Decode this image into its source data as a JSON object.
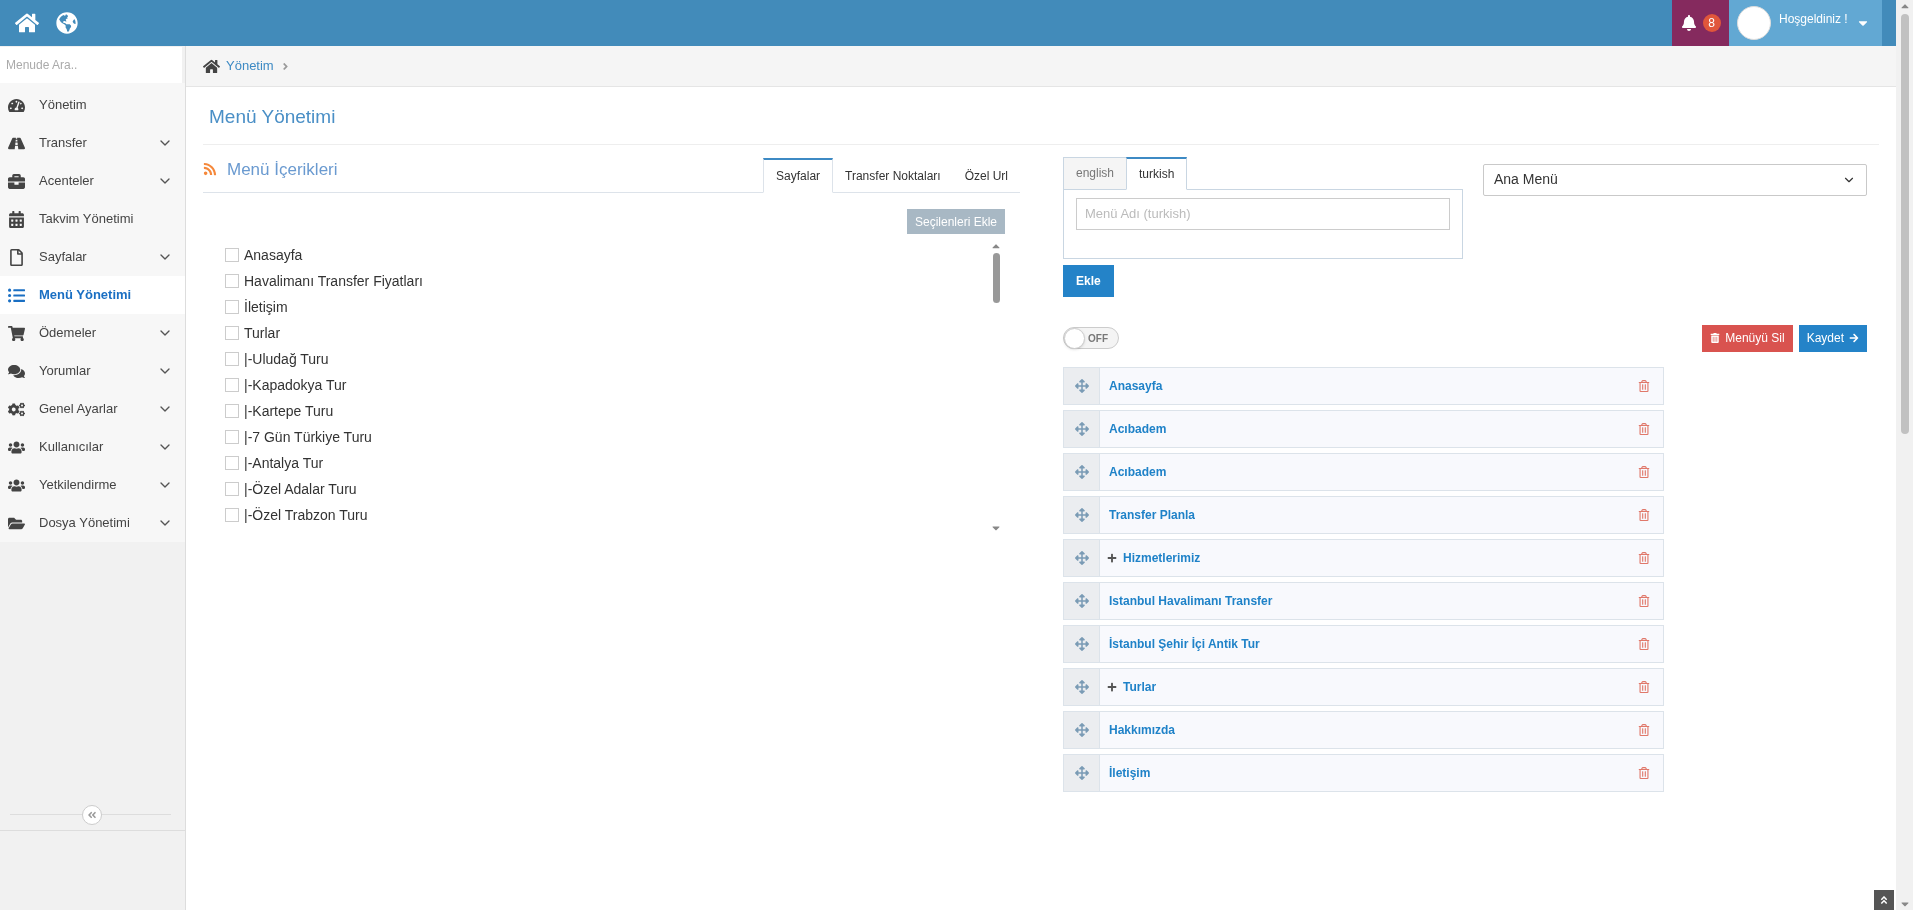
{
  "top_bar": {
    "notifications": {
      "count": "8"
    },
    "user": {
      "greeting": "Hoşgeldiniz !"
    }
  },
  "sidebar": {
    "search": {
      "placeholder": "Menude Ara.."
    },
    "items": [
      {
        "label": "Yönetim",
        "expandable": false,
        "selected": false
      },
      {
        "label": "Transfer",
        "expandable": true,
        "selected": false
      },
      {
        "label": "Acenteler",
        "expandable": true,
        "selected": false
      },
      {
        "label": "Takvim Yönetimi",
        "expandable": false,
        "selected": false
      },
      {
        "label": "Sayfalar",
        "expandable": true,
        "selected": false
      },
      {
        "label": "Menü Yönetimi",
        "expandable": false,
        "selected": true
      },
      {
        "label": "Ödemeler",
        "expandable": true,
        "selected": false
      },
      {
        "label": "Yorumlar",
        "expandable": true,
        "selected": false
      },
      {
        "label": "Genel Ayarlar",
        "expandable": true,
        "selected": false
      },
      {
        "label": "Kullanıcılar",
        "expandable": true,
        "selected": false
      },
      {
        "label": "Yetkilendirme",
        "expandable": true,
        "selected": false
      },
      {
        "label": "Dosya Yönetimi",
        "expandable": true,
        "selected": false
      }
    ]
  },
  "breadcrumb": [
    "Yönetim"
  ],
  "page_title": "Menü Yönetimi",
  "menu_contents": {
    "title": "Menü İçerikleri",
    "tabs": [
      {
        "label": "Sayfalar",
        "selected": true
      },
      {
        "label": "Transfer Noktaları",
        "selected": false
      },
      {
        "label": "Özel Url",
        "selected": false
      }
    ],
    "add_selected_button": "Seçilenleri Ekle",
    "pages": [
      {
        "label": "Anasayfa",
        "checked": false
      },
      {
        "label": "Havalimanı Transfer Fiyatları",
        "checked": false
      },
      {
        "label": "İletişim",
        "checked": false
      },
      {
        "label": "Turlar",
        "checked": false
      },
      {
        "label": "|-Uludağ Turu",
        "checked": false
      },
      {
        "label": "|-Kapadokya Tur",
        "checked": false
      },
      {
        "label": "|-Kartepe Turu",
        "checked": false
      },
      {
        "label": "|-7 Gün Türkiye Turu",
        "checked": false
      },
      {
        "label": "|-Antalya Tur",
        "checked": false
      },
      {
        "label": "|-Özel Adalar Turu",
        "checked": false
      },
      {
        "label": "|-Özel Trabzon Turu",
        "checked": false
      }
    ]
  },
  "menu_editor": {
    "language_tabs": [
      {
        "label": "english",
        "selected": false
      },
      {
        "label": "turkish",
        "selected": true
      }
    ],
    "name_field": {
      "placeholder": "Menü Adı (turkish)"
    },
    "add_button": "Ekle",
    "menu_select": {
      "value": "Ana Menü"
    },
    "toggle": {
      "on": false,
      "label": "OFF"
    },
    "delete_menu_button": "Menüyü Sil",
    "save_button": "Kaydet",
    "items": [
      {
        "label": "Anasayfa",
        "has_children": false
      },
      {
        "label": "Acıbadem",
        "has_children": false
      },
      {
        "label": "Acıbadem",
        "has_children": false
      },
      {
        "label": "Transfer Planla",
        "has_children": false
      },
      {
        "label": "Hizmetlerimiz",
        "has_children": true
      },
      {
        "label": "Istanbul Havalimanı Transfer",
        "has_children": false
      },
      {
        "label": "İstanbul Şehir İçi Antik Tur",
        "has_children": false
      },
      {
        "label": "Turlar",
        "has_children": true
      },
      {
        "label": "Hakkımızda",
        "has_children": false
      },
      {
        "label": "İletişim",
        "has_children": false
      }
    ]
  }
}
